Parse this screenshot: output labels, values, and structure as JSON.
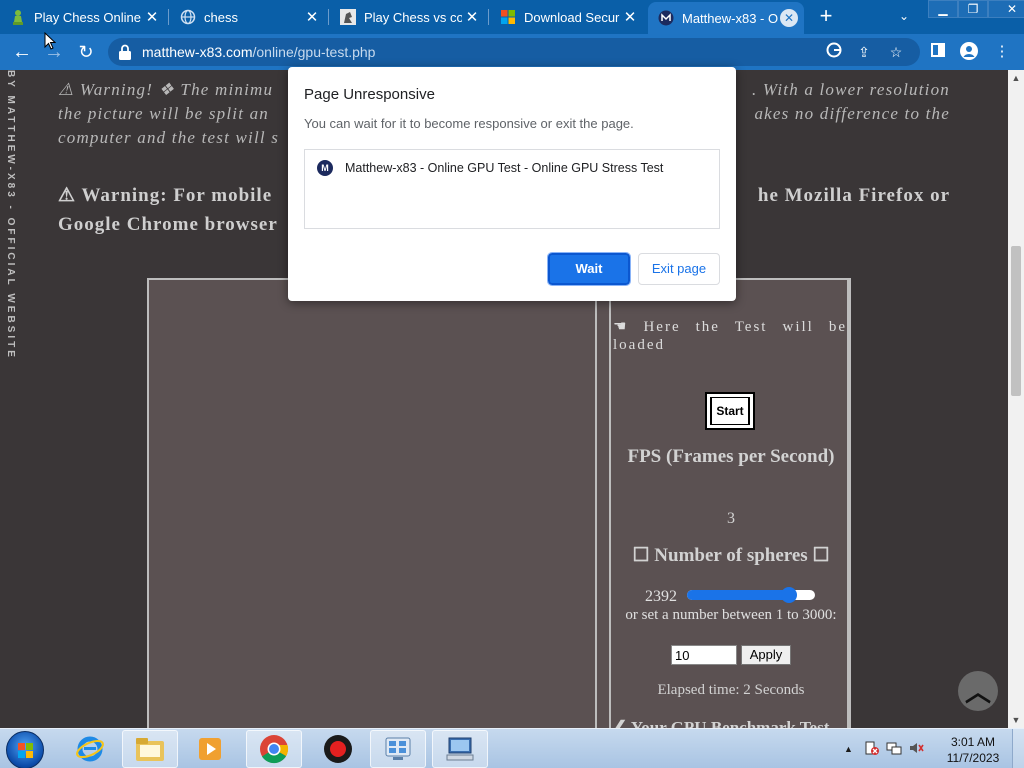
{
  "browser": {
    "tabs": [
      {
        "title": "Play Chess Online",
        "icon": "pawn-icon"
      },
      {
        "title": "chess",
        "icon": "globe-icon"
      },
      {
        "title": "Play Chess vs com",
        "icon": "chess-site-icon"
      },
      {
        "title": "Download Securit",
        "icon": "microsoft-icon"
      },
      {
        "title": "Matthew-x83 - O",
        "icon": "matthew-x83-icon"
      }
    ],
    "url_host": "matthew-x83.com",
    "url_path": "/online/gpu-test.php",
    "accent_color": "#1f74c3"
  },
  "page": {
    "sidebar_text": "BY MATTHEW-X83 - OFFICIAL WEBSITE",
    "warning1_left": "⚠ Warning! ❖ The minimu",
    "warning1_right": ". With a lower resolution",
    "warning1_line2_left": "the picture will be split an",
    "warning1_line2_right": "akes no difference to the",
    "warning1_line3_left": "computer and the test will s",
    "warning2_line1_left": "⚠ Warning: For mobile",
    "warning2_line1_right": "he Mozilla Firefox or",
    "warning2_line2_left": "Google Chrome browser",
    "test_loaded_text": "☚ Here the Test will be loaded",
    "start_label": "Start",
    "fps_title": "FPS (Frames per Second)",
    "fps_value": "3",
    "spheres_title": "☐ Number of spheres ☐",
    "sphere_count": "2392",
    "slider_fraction": 0.797,
    "set_number_text": "or set a number between 1 to 3000:",
    "number_input_value": "10",
    "apply_label": "Apply",
    "elapsed_text": "Elapsed time: 2 Seconds",
    "cut_heading": "❮ Your GPU Benchmark Test"
  },
  "dialog": {
    "title": "Page Unresponsive",
    "message": "You can wait for it to become responsive or exit the page.",
    "item": "Matthew-x83 - Online GPU Test - Online GPU Stress Test",
    "wait_label": "Wait",
    "exit_label": "Exit page"
  },
  "taskbar": {
    "time": "3:01 AM",
    "date": "11/7/2023"
  }
}
